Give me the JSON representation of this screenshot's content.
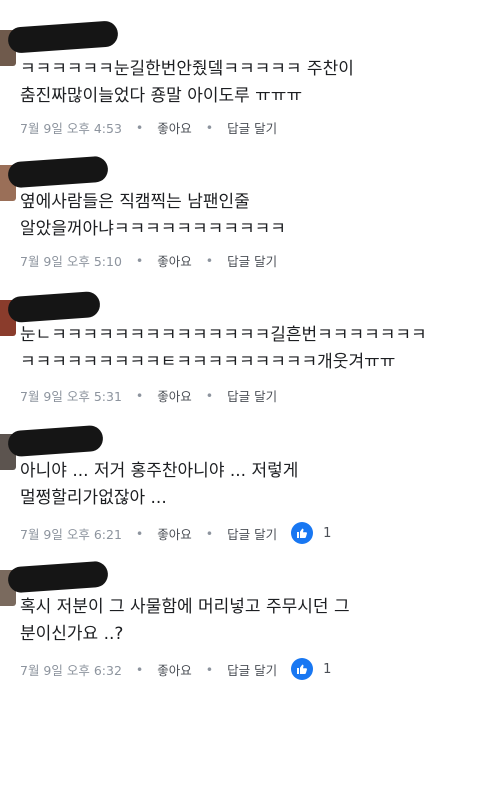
{
  "comments": [
    {
      "lines": [
        "ㅋㅋㅋㅋㅋㅋ눈길한번안줬뎈ㅋㅋㅋㅋㅋ 주찬이",
        "춤진짜많이늘었다 죵말 아이도루 ㅠㅠㅠ"
      ],
      "time": "7월 9일 오후 4:53",
      "like_label": "좋아요",
      "reply_label": "답글 달기"
    },
    {
      "lines": [
        "옆에사람들은 직캠찍는 남팬인줄",
        "알았을꺼아냐ㅋㅋㅋㅋㅋㅋㅋㅋㅋㅋㅋ"
      ],
      "time": "7월 9일 오후 5:10",
      "like_label": "좋아요",
      "reply_label": "답글 달기"
    },
    {
      "lines": [
        "눈ㄴㅋㅋㅋㅋㅋㅋㅋㅋㅋㅋㅋㅋㅋㅋ길흔번ㅋㅋㅋㅋㅋㅋㅋ",
        "ㅋㅋㅋㅋㅋㅋㅋㅋㅋㅌㅋㅋㅋㅋㅋㅋㅋㅋㅋ개웃겨ㅠㅠ"
      ],
      "time": "7월 9일 오후 5:31",
      "like_label": "좋아요",
      "reply_label": "답글 달기"
    },
    {
      "lines": [
        "아니야 ... 저거 홍주찬아니야 ... 저렇게",
        "멀쩡할리가없잖아 ..."
      ],
      "time": "7월 9일 오후 6:21",
      "like_label": "좋아요",
      "reply_label": "답글 달기",
      "reaction_icon": "thumbs-up-icon",
      "reaction_count": "1"
    },
    {
      "lines": [
        "혹시 저분이 그 사물함에 머리넣고 주무시던 그",
        "분이신가요 ..?"
      ],
      "time": "7월 9일 오후 6:32",
      "like_label": "좋아요",
      "reply_label": "답글 달기",
      "reaction_icon": "thumbs-up-icon",
      "reaction_count": "1"
    }
  ],
  "colors": {
    "text": "#1c1e21",
    "meta": "#8d949e",
    "reaction_blue": "#1877f2"
  }
}
